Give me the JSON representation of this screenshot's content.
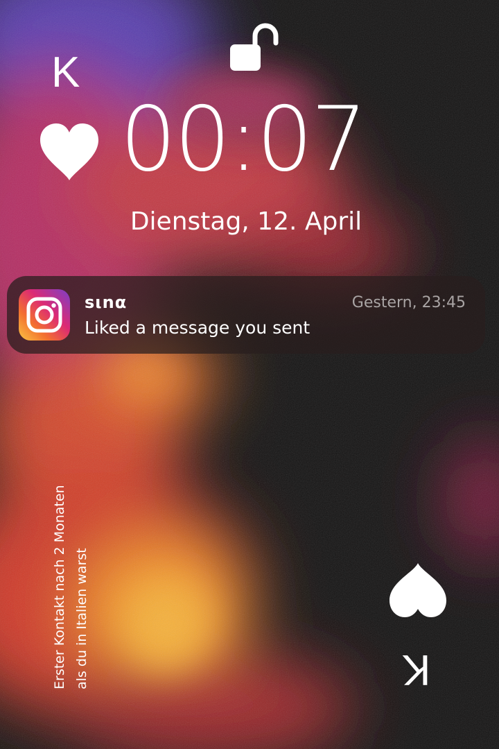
{
  "lockscreen": {
    "time": "00:07",
    "date": "Dienstag, 12. April"
  },
  "card": {
    "rank_top": "K",
    "rank_bottom": "K",
    "top_suit": "heart-icon",
    "bottom_suit": "spade-icon"
  },
  "notification": {
    "app_icon": "instagram-icon",
    "sender": "sιnα",
    "time": "Gestern, 23:45",
    "body": "Liked a message you sent"
  },
  "caption": {
    "line1": "Erster Kontakt nach 2 Monaten",
    "line2": "als du in Italien warst"
  },
  "colors": {
    "notification_bg": "#281e1e",
    "secondary_text": "#a9a4a4",
    "background": "#121212"
  }
}
